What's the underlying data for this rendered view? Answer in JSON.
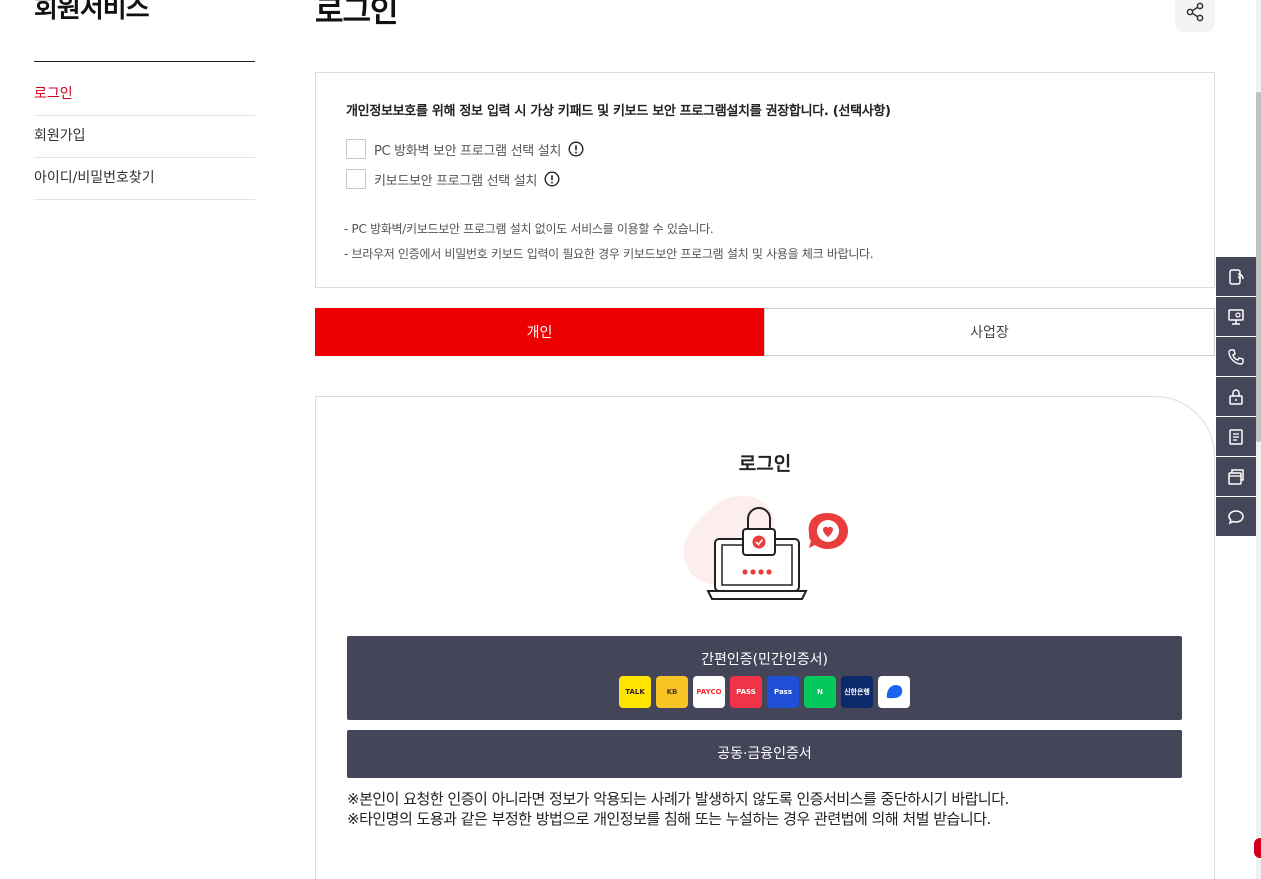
{
  "sidebar": {
    "title": "회원서비스",
    "items": [
      {
        "label": "로그인",
        "active": true
      },
      {
        "label": "회원가입",
        "active": false
      },
      {
        "label": "아이디/비밀번호찾기",
        "active": false
      }
    ]
  },
  "header": {
    "title": "로그인",
    "share_icon": "share-icon"
  },
  "security_notice": {
    "text": "개인정보보호를 위해 정보 입력 시 가상 키패드 및 키보드 보안 프로그램설치를 권장합니다. (선택사항)",
    "options": [
      {
        "label": "PC 방화벽 보안 프로그램 선택 설치",
        "checked": false
      },
      {
        "label": "키보드보안 프로그램 선택 설치",
        "checked": false
      }
    ],
    "notes": [
      "- PC 방화벽/키보드보안 프로그램 설치 없이도 서비스를 이용할 수 있습니다.",
      "- 브라우저 인증에서 비밀번호 키보드 입력이 필요한 경우 키보드보안 프로그램 설치 및 사용을 체크 바랍니다."
    ]
  },
  "tabs": [
    {
      "label": "개인",
      "active": true
    },
    {
      "label": "사업장",
      "active": false
    }
  ],
  "login": {
    "heading": "로그인",
    "simple_auth_label": "간편인증(민간인증서)",
    "providers": [
      {
        "name": "kakao",
        "text": "TALK",
        "bg": "#fee500",
        "fg": "#3c1e1e"
      },
      {
        "name": "kb",
        "text": "KB",
        "bg": "#f7c325",
        "fg": "#4a3b2a"
      },
      {
        "name": "payco",
        "text": "PAYCO",
        "bg": "#ffffff",
        "fg": "#ff2a2a"
      },
      {
        "name": "pass",
        "text": "PASS",
        "bg": "#f03349",
        "fg": "#ffffff"
      },
      {
        "name": "samsung-pass",
        "text": "Pass",
        "bg": "#1f4fd6",
        "fg": "#ffffff"
      },
      {
        "name": "naver",
        "text": "N",
        "bg": "#03c75a",
        "fg": "#ffffff"
      },
      {
        "name": "shinhan",
        "text": "신한은행",
        "bg": "#0b2a6b",
        "fg": "#ffffff"
      },
      {
        "name": "toss",
        "text": "",
        "bg": "#ffffff",
        "fg": "#1b64f2"
      }
    ],
    "cert_auth_label": "공동·금융인증서",
    "warnings": [
      "※본인이 요청한 인증이 아니라면 정보가 악용되는 사례가 발생하지 않도록 인증서비스를 중단하시기 바랍니다.",
      "※타인명의 도용과 같은 부정한 방법으로 개인정보를 침해 또는 누설하는 경우 관련법에 의해 처벌 받습니다."
    ]
  },
  "quick_menu": [
    "remote-support-icon",
    "monitor-icon",
    "phone-icon",
    "lock-icon",
    "document-icon",
    "browser-icon",
    "chat-icon"
  ],
  "colors": {
    "accent": "#ee0000",
    "sidebar_active": "#d4001c",
    "button_bg": "#454559",
    "quick_menu_bg": "#46465a"
  }
}
